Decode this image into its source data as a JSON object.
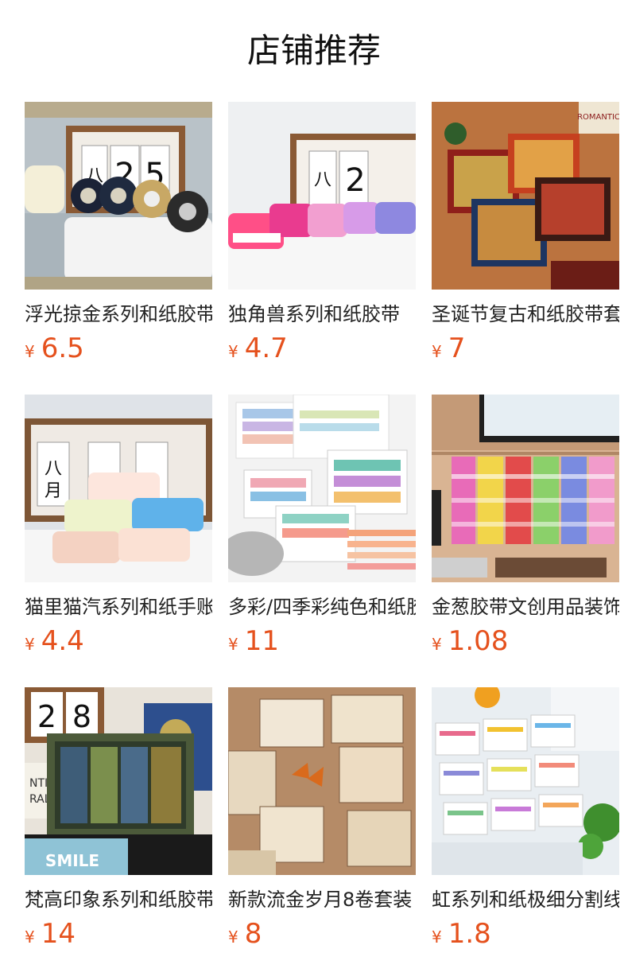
{
  "section": {
    "title": "店铺推荐"
  },
  "currency_symbol": "¥",
  "products": [
    {
      "name": "浮光掠金系列和纸胶带",
      "price": "6.5",
      "image": "washi-tape-calendar-gold"
    },
    {
      "name": "独角兽系列和纸胶带",
      "price": "4.7",
      "image": "washi-tape-unicorn"
    },
    {
      "name": "圣诞节复古和纸胶带套装",
      "price": "7",
      "image": "washi-tape-christmas-boxes"
    },
    {
      "name": "猫里猫汽系列和纸手账胶带",
      "price": "4.4",
      "image": "washi-tape-cats"
    },
    {
      "name": "多彩/四季彩纯色和纸胶带",
      "price": "11",
      "image": "washi-tape-rainbow-boxes"
    },
    {
      "name": "金葱胶带文创用品装饰",
      "price": "1.08",
      "image": "washi-tape-glitter"
    },
    {
      "name": "梵高印象系列和纸胶带",
      "price": "14",
      "image": "washi-tape-van-gogh"
    },
    {
      "name": "新款流金岁月8卷套装",
      "price": "8",
      "image": "washi-tape-vintage"
    },
    {
      "name": "虹系列和纸极细分割线胶带",
      "price": "1.8",
      "image": "washi-tape-thin-rainbow"
    }
  ]
}
